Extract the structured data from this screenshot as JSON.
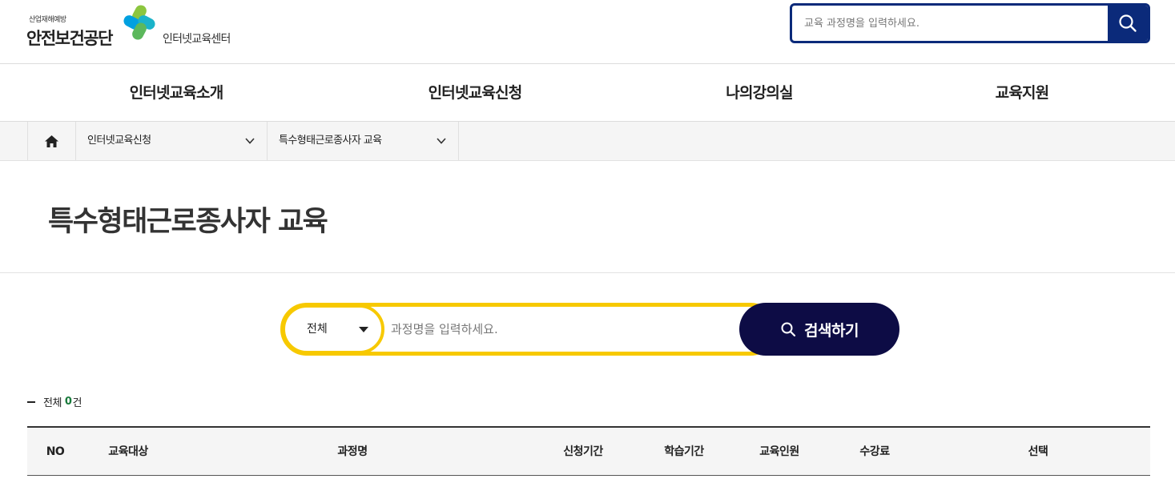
{
  "header": {
    "logo_small": "산업재해예방",
    "logo_main": "안전보건공단",
    "logo_sub": "인터넷교육센터",
    "search_placeholder": "교육 과정명을 입력하세요.",
    "search_icon": "search-icon",
    "brand_color": "#0b2a7a"
  },
  "gnb": {
    "items": [
      "인터넷교육소개",
      "인터넷교육신청",
      "나의강의실",
      "교육지원"
    ]
  },
  "breadcrumb": {
    "home_icon": "home-icon",
    "level1": "인터넷교육신청",
    "level2": "특수형태근로종사자 교육"
  },
  "page": {
    "title": "특수형태근로종사자 교육"
  },
  "search": {
    "select_value": "전체",
    "placeholder": "과정명을 입력하세요.",
    "button_label": "검색하기",
    "accent_color": "#f7c900",
    "button_color": "#0d0c45"
  },
  "results": {
    "prefix": "전체",
    "count": "0",
    "suffix": "건"
  },
  "table": {
    "columns": [
      "NO",
      "교육대상",
      "과정명",
      "신청기간",
      "학습기간",
      "교육인원",
      "수강료",
      "선택"
    ]
  }
}
